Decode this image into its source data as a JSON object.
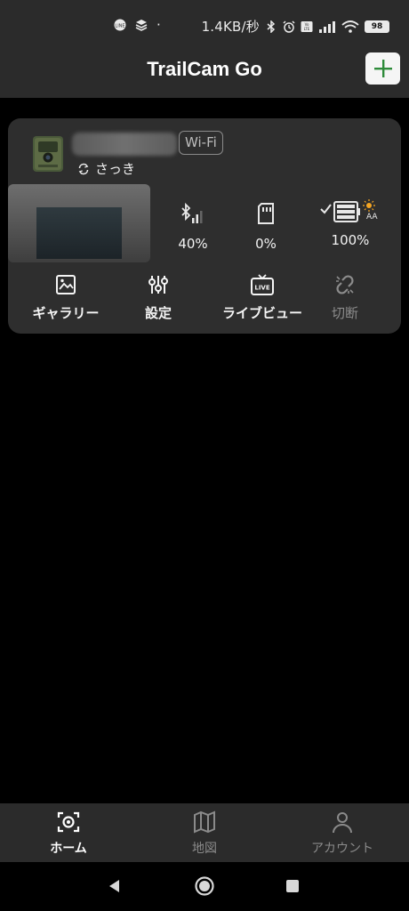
{
  "status_bar": {
    "dot": "·",
    "network_speed": "1.4KB/秒",
    "battery": "98",
    "icons": [
      "line-icon",
      "layers-icon",
      "bluetooth-icon",
      "alarm-icon",
      "volte-icon",
      "signal-icon",
      "wifi-icon",
      "battery-icon"
    ]
  },
  "header": {
    "title": "TrailCam Go",
    "add_icon": "plus-icon"
  },
  "camera_card": {
    "connection_badge": "Wi-Fi",
    "sync_label": "さっき",
    "stats": [
      {
        "icon": "bluetooth-signal-icon",
        "value": "40%"
      },
      {
        "icon": "sd-card-icon",
        "value": "0%"
      },
      {
        "icon": "battery-pack-icon",
        "value": "100%",
        "sub": "AA"
      }
    ],
    "actions": {
      "gallery": "ギャラリー",
      "settings": "設定",
      "live_view": "ライブビュー",
      "disconnect": "切断"
    }
  },
  "tab_bar": {
    "home": "ホーム",
    "map": "地図",
    "account": "アカウント"
  },
  "colors": {
    "bar_bg": "#2b2b2b",
    "card_bg": "#2e2e2e",
    "accent_green": "#2e8b3a",
    "battery_sun": "#f5a623"
  }
}
